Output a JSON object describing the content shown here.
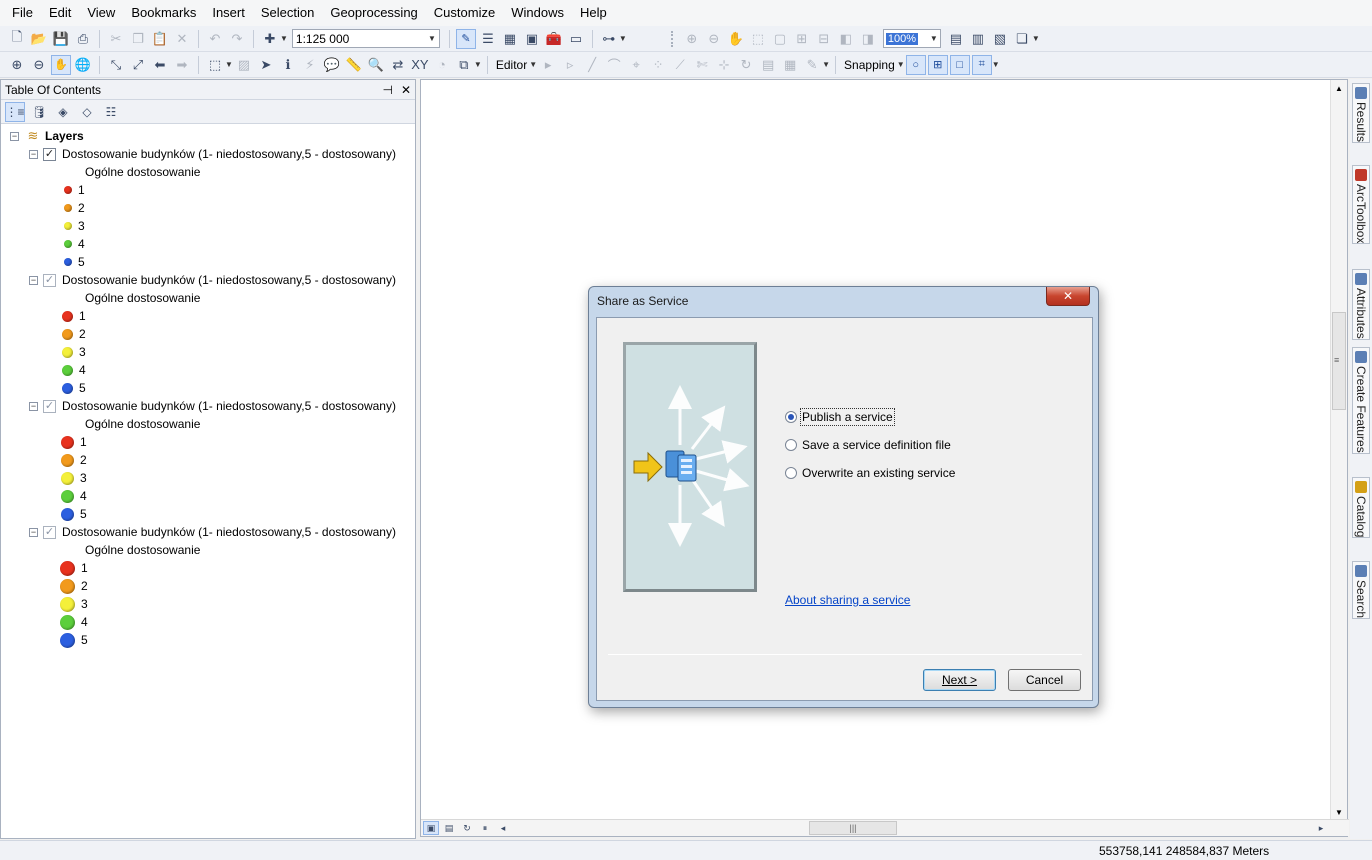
{
  "menubar": {
    "items": [
      "File",
      "Edit",
      "View",
      "Bookmarks",
      "Insert",
      "Selection",
      "Geoprocessing",
      "Customize",
      "Windows",
      "Help"
    ]
  },
  "toolbar": {
    "scale": "1:125 000",
    "zoom": "100%",
    "editor_label": "Editor",
    "snapping_label": "Snapping"
  },
  "toc": {
    "title": "Table Of Contents",
    "root_label": "Layers",
    "layers": [
      {
        "name": "Dostosowanie budynków (1- niedostosowany,5 - dostosowany)",
        "checked": true,
        "heading": "Ogólne dostosowanie",
        "classes": [
          "1",
          "2",
          "3",
          "4",
          "5"
        ]
      },
      {
        "name": "Dostosowanie budynków (1- niedostosowany,5 - dostosowany)",
        "checked": true,
        "heading": "Ogólne dostosowanie",
        "classes": [
          "1",
          "2",
          "3",
          "4",
          "5"
        ]
      },
      {
        "name": "Dostosowanie budynków (1- niedostosowany,5 - dostosowany)",
        "checked": true,
        "heading": "Ogólne dostosowanie",
        "classes": [
          "1",
          "2",
          "3",
          "4",
          "5"
        ]
      },
      {
        "name": "Dostosowanie budynków (1- niedostosowany,5 - dostosowany)",
        "checked": true,
        "heading": "Ogólne dostosowanie",
        "classes": [
          "1",
          "2",
          "3",
          "4",
          "5"
        ]
      }
    ],
    "class_colors": [
      "#e8321e",
      "#f29a1c",
      "#f4f03a",
      "#5ccf3c",
      "#2c5fe0"
    ]
  },
  "dock": {
    "tabs": [
      "Results",
      "ArcToolbox",
      "Attributes",
      "Create Features",
      "Catalog",
      "Search"
    ]
  },
  "status": {
    "coordinates": "553758,141  248584,837 Meters"
  },
  "dialog": {
    "title": "Share as Service",
    "close_symbol": "✕",
    "options": [
      {
        "label": "Publish a service",
        "selected": true
      },
      {
        "label": "Save a service definition file",
        "selected": false
      },
      {
        "label": "Overwrite an existing service",
        "selected": false
      }
    ],
    "link": "About sharing a service",
    "next_label": "Next >",
    "cancel_label": "Cancel"
  }
}
